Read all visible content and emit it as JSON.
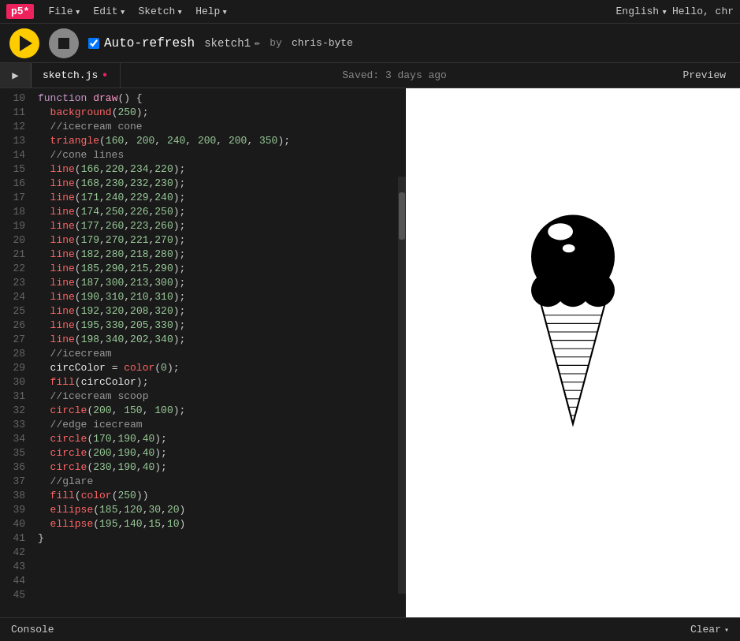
{
  "topbar": {
    "logo": "p5*",
    "menus": [
      {
        "label": "File",
        "id": "file-menu"
      },
      {
        "label": "Edit",
        "id": "edit-menu"
      },
      {
        "label": "Sketch",
        "id": "sketch-menu"
      },
      {
        "label": "Help",
        "id": "help-menu"
      }
    ],
    "language": "English",
    "greeting": "Hello, chr"
  },
  "toolbar": {
    "play_label": "Play",
    "stop_label": "Stop",
    "auto_refresh_label": "Auto-refresh",
    "auto_refresh_checked": true,
    "sketch_name": "sketch1",
    "by_label": "by",
    "author": "chris-byte"
  },
  "tabs": {
    "arrow_label": "▶",
    "items": [
      {
        "label": "sketch.js",
        "active": true,
        "modified": true
      }
    ],
    "saved_text": "Saved: 3 days ago",
    "preview_label": "Preview"
  },
  "console": {
    "label": "Console",
    "clear_label": "Clear",
    "chevron": "▾"
  },
  "code": {
    "lines": [
      {
        "n": 10,
        "html": "<span class='kw'>function</span> <span class='fn'>draw</span><span class='punc'>() {</span>"
      },
      {
        "n": 11,
        "html": "  <span class='func-call'>background</span><span class='punc'>(</span><span class='num'>250</span><span class='punc'>);</span>"
      },
      {
        "n": 12,
        "html": "  <span class='cm'>//icecream cone</span>"
      },
      {
        "n": 13,
        "html": "  <span class='func-call'>triangle</span><span class='punc'>(</span><span class='num'>160</span><span class='punc'>,</span> <span class='num'>200</span><span class='punc'>,</span> <span class='num'>240</span><span class='punc'>,</span> <span class='num'>200</span><span class='punc'>,</span> <span class='num'>200</span><span class='punc'>,</span> <span class='num'>350</span><span class='punc'>);</span>"
      },
      {
        "n": 14,
        "html": ""
      },
      {
        "n": 15,
        "html": "  <span class='cm'>//cone lines</span>"
      },
      {
        "n": 16,
        "html": "  <span class='func-call'>line</span><span class='punc'>(</span><span class='num'>166</span><span class='punc'>,</span><span class='num'>220</span><span class='punc'>,</span><span class='num'>234</span><span class='punc'>,</span><span class='num'>220</span><span class='punc'>);</span>"
      },
      {
        "n": 17,
        "html": "  <span class='func-call'>line</span><span class='punc'>(</span><span class='num'>168</span><span class='punc'>,</span><span class='num'>230</span><span class='punc'>,</span><span class='num'>232</span><span class='punc'>,</span><span class='num'>230</span><span class='punc'>);</span>"
      },
      {
        "n": 18,
        "html": "  <span class='func-call'>line</span><span class='punc'>(</span><span class='num'>171</span><span class='punc'>,</span><span class='num'>240</span><span class='punc'>,</span><span class='num'>229</span><span class='punc'>,</span><span class='num'>240</span><span class='punc'>);</span>"
      },
      {
        "n": 19,
        "html": "  <span class='func-call'>line</span><span class='punc'>(</span><span class='num'>174</span><span class='punc'>,</span><span class='num'>250</span><span class='punc'>,</span><span class='num'>226</span><span class='punc'>,</span><span class='num'>250</span><span class='punc'>);</span>"
      },
      {
        "n": 20,
        "html": "  <span class='func-call'>line</span><span class='punc'>(</span><span class='num'>177</span><span class='punc'>,</span><span class='num'>260</span><span class='punc'>,</span><span class='num'>223</span><span class='punc'>,</span><span class='num'>260</span><span class='punc'>);</span>"
      },
      {
        "n": 21,
        "html": "  <span class='func-call'>line</span><span class='punc'>(</span><span class='num'>179</span><span class='punc'>,</span><span class='num'>270</span><span class='punc'>,</span><span class='num'>221</span><span class='punc'>,</span><span class='num'>270</span><span class='punc'>);</span>"
      },
      {
        "n": 22,
        "html": "  <span class='func-call'>line</span><span class='punc'>(</span><span class='num'>182</span><span class='punc'>,</span><span class='num'>280</span><span class='punc'>,</span><span class='num'>218</span><span class='punc'>,</span><span class='num'>280</span><span class='punc'>);</span>"
      },
      {
        "n": 23,
        "html": "  <span class='func-call'>line</span><span class='punc'>(</span><span class='num'>185</span><span class='punc'>,</span><span class='num'>290</span><span class='punc'>,</span><span class='num'>215</span><span class='punc'>,</span><span class='num'>290</span><span class='punc'>);</span>"
      },
      {
        "n": 24,
        "html": "  <span class='func-call'>line</span><span class='punc'>(</span><span class='num'>187</span><span class='punc'>,</span><span class='num'>300</span><span class='punc'>,</span><span class='num'>213</span><span class='punc'>,</span><span class='num'>300</span><span class='punc'>);</span>"
      },
      {
        "n": 25,
        "html": "  <span class='func-call'>line</span><span class='punc'>(</span><span class='num'>190</span><span class='punc'>,</span><span class='num'>310</span><span class='punc'>,</span><span class='num'>210</span><span class='punc'>,</span><span class='num'>310</span><span class='punc'>);</span>"
      },
      {
        "n": 26,
        "html": "  <span class='func-call'>line</span><span class='punc'>(</span><span class='num'>192</span><span class='punc'>,</span><span class='num'>320</span><span class='punc'>,</span><span class='num'>208</span><span class='punc'>,</span><span class='num'>320</span><span class='punc'>);</span>"
      },
      {
        "n": 27,
        "html": "  <span class='func-call'>line</span><span class='punc'>(</span><span class='num'>195</span><span class='punc'>,</span><span class='num'>330</span><span class='punc'>,</span><span class='num'>205</span><span class='punc'>,</span><span class='num'>330</span><span class='punc'>);</span>"
      },
      {
        "n": 28,
        "html": "  <span class='func-call'>line</span><span class='punc'>(</span><span class='num'>198</span><span class='punc'>,</span><span class='num'>340</span><span class='punc'>,</span><span class='num'>202</span><span class='punc'>,</span><span class='num'>340</span><span class='punc'>);</span>"
      },
      {
        "n": 29,
        "html": ""
      },
      {
        "n": 30,
        "html": "  <span class='cm'>//icecream</span>"
      },
      {
        "n": 31,
        "html": "  <span class='white'>circColor</span> <span class='punc'>=</span> <span class='func-call'>color</span><span class='punc'>(</span><span class='num'>0</span><span class='punc'>);</span>"
      },
      {
        "n": 32,
        "html": "  <span class='func-call'>fill</span><span class='punc'>(</span><span class='white'>circColor</span><span class='punc'>);</span>"
      },
      {
        "n": 33,
        "html": "  <span class='cm'>//icecream scoop</span>"
      },
      {
        "n": 34,
        "html": "  <span class='func-call'>circle</span><span class='punc'>(</span><span class='num'>200</span><span class='punc'>,</span> <span class='num'>150</span><span class='punc'>,</span> <span class='num'>100</span><span class='punc'>);</span>"
      },
      {
        "n": 35,
        "html": "  <span class='cm'>//edge icecream</span>"
      },
      {
        "n": 36,
        "html": "  <span class='func-call'>circle</span><span class='punc'>(</span><span class='num'>170</span><span class='punc'>,</span><span class='num'>190</span><span class='punc'>,</span><span class='num'>40</span><span class='punc'>);</span>"
      },
      {
        "n": 37,
        "html": "  <span class='func-call'>circle</span><span class='punc'>(</span><span class='num'>200</span><span class='punc'>,</span><span class='num'>190</span><span class='punc'>,</span><span class='num'>40</span><span class='punc'>);</span>"
      },
      {
        "n": 38,
        "html": "  <span class='func-call'>circle</span><span class='punc'>(</span><span class='num'>230</span><span class='punc'>,</span><span class='num'>190</span><span class='punc'>,</span><span class='num'>40</span><span class='punc'>);</span>"
      },
      {
        "n": 39,
        "html": ""
      },
      {
        "n": 40,
        "html": "  <span class='cm'>//glare</span>"
      },
      {
        "n": 41,
        "html": "  <span class='func-call'>fill</span><span class='punc'>(</span><span class='func-call'>color</span><span class='punc'>(</span><span class='num'>250</span><span class='punc'>))</span>"
      },
      {
        "n": 42,
        "html": "  <span class='func-call'>ellipse</span><span class='punc'>(</span><span class='num'>185</span><span class='punc'>,</span><span class='num'>120</span><span class='punc'>,</span><span class='num'>30</span><span class='punc'>,</span><span class='num'>20</span><span class='punc'>)</span>"
      },
      {
        "n": 43,
        "html": "  <span class='func-call'>ellipse</span><span class='punc'>(</span><span class='num'>195</span><span class='punc'>,</span><span class='num'>140</span><span class='punc'>,</span><span class='num'>15</span><span class='punc'>,</span><span class='num'>10</span><span class='punc'>)</span>"
      },
      {
        "n": 44,
        "html": "<span class='punc'>}</span>"
      },
      {
        "n": 45,
        "html": ""
      }
    ]
  }
}
